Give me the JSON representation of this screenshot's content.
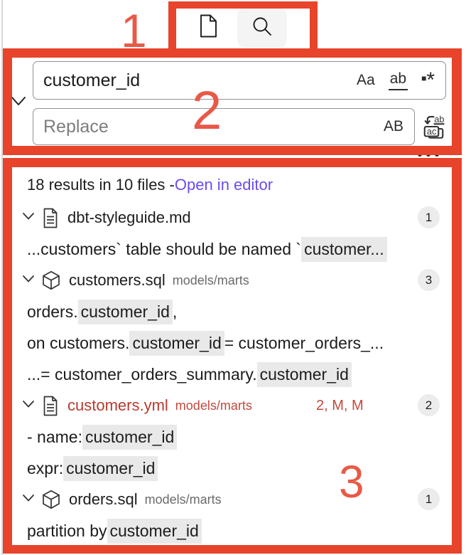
{
  "annotations": {
    "box1_label": "1",
    "box2_label": "2",
    "box3_label": "3",
    "box_color": "#e8432b",
    "number_color": "#e85947"
  },
  "toolbar": {
    "tabs": [
      {
        "icon": "new-file-icon",
        "active": false
      },
      {
        "icon": "search-icon",
        "active": true
      }
    ]
  },
  "search_panel": {
    "query": "customer_id",
    "match_case_label": "Aa",
    "whole_word_label": "ab",
    "regex_square": "■",
    "regex_star": "*",
    "replace_placeholder": "Replace",
    "preserve_case_label": "AB",
    "toggle_replace_icon": "chevron-down-icon",
    "replace_all_icon": "replace-all-icon",
    "more_actions_icon": "more-actions-icon"
  },
  "results": {
    "summary_text": "18 results in 10 files - ",
    "open_in_editor_link": "Open in editor",
    "files": [
      {
        "name": "dbt-styleguide.md",
        "path": "",
        "icon": "file-icon",
        "badge": "1",
        "decoration": "",
        "error": false,
        "matches": [
          {
            "pre": "...customers` table should be named `",
            "match": "customer...",
            "post": ""
          }
        ]
      },
      {
        "name": "customers.sql",
        "path": "models/marts",
        "icon": "cube-icon",
        "badge": "3",
        "decoration": "",
        "error": false,
        "matches": [
          {
            "pre": "orders.",
            "match": "customer_id",
            "post": ","
          },
          {
            "pre": "on customers.",
            "match": "customer_id",
            "post": " = customer_orders_..."
          },
          {
            "pre": "...= customer_orders_summary.",
            "match": "customer_id",
            "post": ""
          }
        ]
      },
      {
        "name": "customers.yml",
        "path": "models/marts",
        "icon": "file-icon",
        "badge": "2",
        "decoration": "2, M, M",
        "error": true,
        "matches": [
          {
            "pre": "- name: ",
            "match": "customer_id",
            "post": ""
          },
          {
            "pre": "expr: ",
            "match": "customer_id",
            "post": ""
          }
        ]
      },
      {
        "name": "orders.sql",
        "path": "models/marts",
        "icon": "cube-icon",
        "badge": "1",
        "decoration": "",
        "error": false,
        "matches": [
          {
            "pre": "partition by ",
            "match": "customer_id",
            "post": ""
          }
        ]
      }
    ]
  },
  "colors": {
    "link_purple": "#6b4cec",
    "error_file_red": "#b83a2e",
    "decoration_red": "#c2493c",
    "match_highlight_gray": "#e9e9e9",
    "badge_bg": "#ececec"
  }
}
